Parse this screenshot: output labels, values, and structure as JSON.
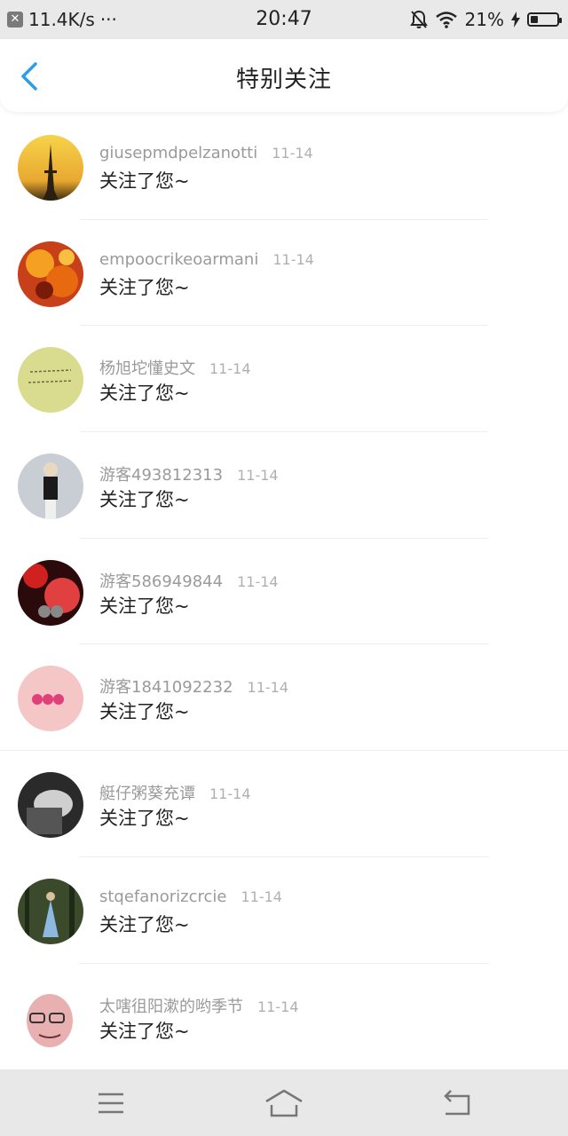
{
  "status_bar": {
    "speed": "11.4K/s",
    "dots": "···",
    "time": "20:47",
    "battery_percent": "21%",
    "battery_level": 0.21
  },
  "header": {
    "title": "特别关注"
  },
  "items": [
    {
      "name": "giusepmdpelzanotti",
      "date": "11-14",
      "text": "关注了您~"
    },
    {
      "name": "empoocrikeoarmani",
      "date": "11-14",
      "text": "关注了您~"
    },
    {
      "name": "杨旭坨懂史文",
      "date": "11-14",
      "text": "关注了您~"
    },
    {
      "name": "游客493812313",
      "date": "11-14",
      "text": "关注了您~"
    },
    {
      "name": "游客586949844",
      "date": "11-14",
      "text": "关注了您~"
    },
    {
      "name": "游客1841092232",
      "date": "11-14",
      "text": "关注了您~"
    },
    {
      "name": "艇仔粥葵充谭",
      "date": "11-14",
      "text": "关注了您~"
    },
    {
      "name": "stqefanorizcrcie",
      "date": "11-14",
      "text": "关注了您~"
    },
    {
      "name": "太嗐徂阳漱的哟季节",
      "date": "11-14",
      "text": "关注了您~"
    }
  ],
  "colors": {
    "accent": "#2a9ee8",
    "statusbar": "#e9e9e9",
    "navbar": "#e8e8e8"
  },
  "icons": [
    "back-chevron-icon",
    "menu-icon",
    "home-icon",
    "return-icon",
    "wifi-icon",
    "mute-bell-icon",
    "battery-icon",
    "charging-icon",
    "notification-x-icon"
  ]
}
